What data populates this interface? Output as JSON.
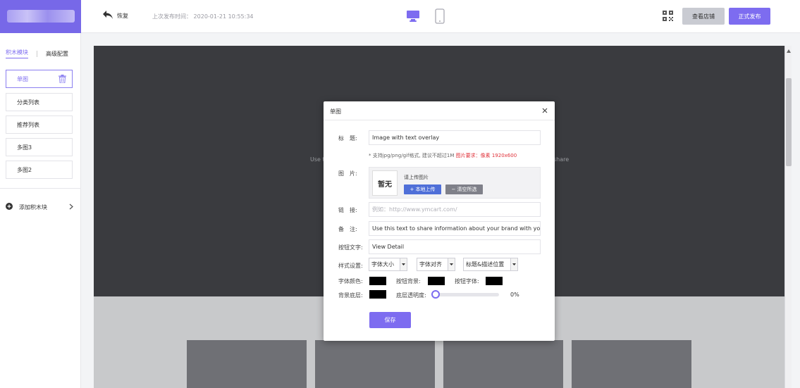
{
  "header": {
    "back_label": "恢复",
    "last_publish_label": "上次发布时间：",
    "last_publish_time": "2020-01-21 10:55:34",
    "view_store_label": "查看店铺",
    "publish_label": "正式发布",
    "icons": [
      "back-arrow-icon",
      "desktop-icon",
      "mobile-icon",
      "qr-code-icon"
    ],
    "accent_color": "#7d6cf0"
  },
  "sidebar": {
    "tabs": [
      "积木模块",
      "高级配置"
    ],
    "active_tab": "积木模块",
    "items": [
      {
        "label": "单图",
        "active": true
      },
      {
        "label": "分类列表"
      },
      {
        "label": "推荐列表"
      },
      {
        "label": "多图3"
      },
      {
        "label": "多图2"
      }
    ],
    "add_label": "添加积木块"
  },
  "canvas": {
    "ghost_left": "Use t",
    "ghost_right": "share"
  },
  "modal": {
    "title": "单图",
    "fields": {
      "title_label": "标　题:",
      "title_value": "Image with text overlay",
      "hint_text": "* 支持jpg/png/gif格式, 建议不超过1M ",
      "hint_red": "图片要求：像素 1920x600",
      "image_label": "图　片:",
      "image_placeholder": "暂无",
      "upload_tip": "请上传图片",
      "upload_button": "+ 本地上传",
      "clear_button": "− 清空所选",
      "link_label": "链　接:",
      "link_placeholder": "例如：http://www.ymcart.com/",
      "note_label": "备　注:",
      "note_value": "Use this text to share information about your brand with your customers.",
      "button_text_label": "按钮文字:",
      "button_text_value": "View Detail",
      "style_label": "样式设置:",
      "font_size_option": "字体大小",
      "font_align_option": "字体对齐",
      "title_pos_option": "标题&描述位置",
      "font_color_label": "字体颜色:",
      "button_bg_label": "按钮背景:",
      "button_font_label": "按钮字体:",
      "bg_layer_label": "背景底层:",
      "opacity_label": "底层透明度:",
      "opacity_value": "0%",
      "opacity_fraction": 0,
      "swatch_color": "#000000"
    },
    "save_label": "保存"
  }
}
